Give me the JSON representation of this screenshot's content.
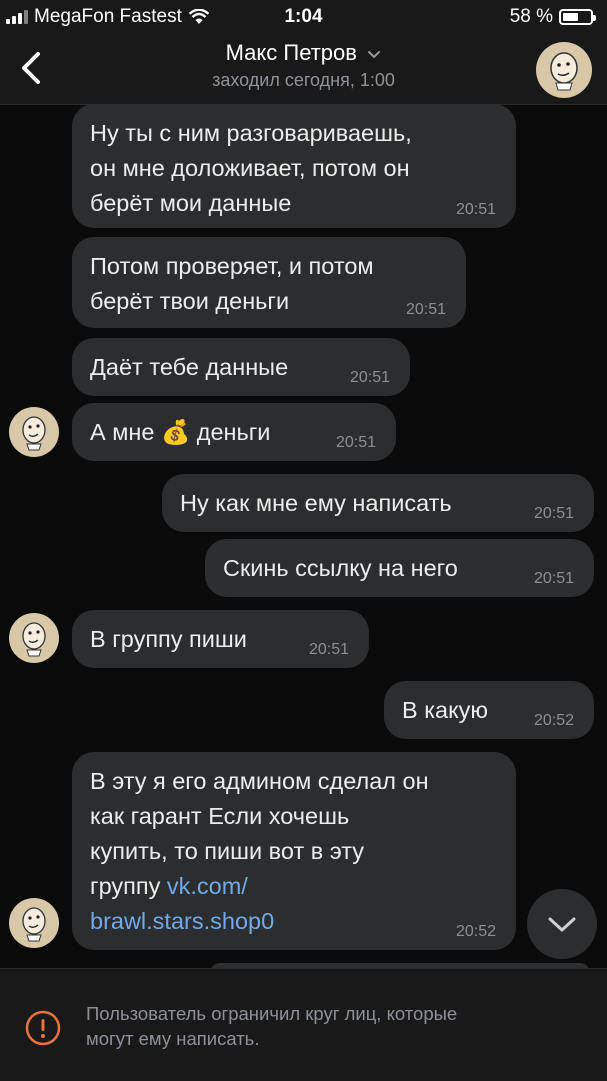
{
  "status_bar": {
    "carrier": "MegaFon Fastest",
    "time": "1:04",
    "battery": "58 %",
    "battery_level": 0.58
  },
  "header": {
    "title": "Макс Петров",
    "subtitle": "заходил сегодня, 1:00"
  },
  "messages": [
    {
      "text": "Ну ты с ним разговариваешь,\nон мне доложивает,  потом  он\nберёт мои данные",
      "time": "20:51"
    },
    {
      "text": "Потом проверяет,  и потом\nберёт твои деньги",
      "time": "20:51"
    },
    {
      "text": "Даёт тебе данные",
      "time": "20:51"
    },
    {
      "text_before": "А мне ",
      "emoji": "💰",
      "text_after": " деньги",
      "time": "20:51"
    },
    {
      "text": "Ну как мне ему написать",
      "time": "20:51"
    },
    {
      "text": "Скинь ссылку на него",
      "time": "20:51"
    },
    {
      "text": "В группу пиши",
      "time": "20:51"
    },
    {
      "text": "В какую",
      "time": "20:52"
    },
    {
      "text": "В эту я его админом сделал он\nкак гарант Если хочешь\nкупить,  то пиши вот в эту\nгруппу ",
      "link": "vk.com/\nbrawl.stars.shop0",
      "time": "20:52"
    }
  ],
  "footer": {
    "notice": "Пользователь ограничил круг лиц, которые\nмогут ему написать."
  },
  "colors": {
    "background": "#0a0a0a",
    "bubble": "#2c2d2e",
    "link": "#71aaeb",
    "bar": "#191919"
  }
}
